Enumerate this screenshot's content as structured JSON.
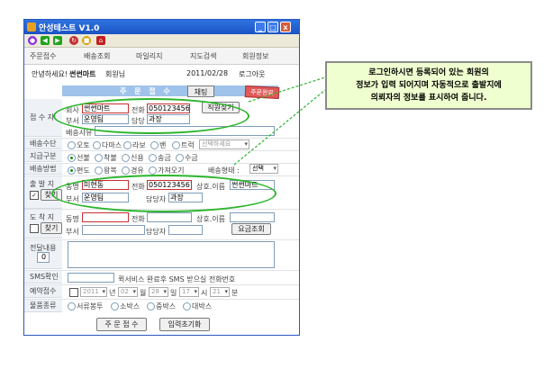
{
  "window": {
    "title": "안성테스트 V1.0",
    "min": "_",
    "max": "□",
    "close": "x"
  },
  "toolbar": {
    "icons": [
      "record-icon",
      "back-arrow-icon",
      "forward-arrow-icon",
      "refresh-icon",
      "stop-icon",
      "home-icon"
    ]
  },
  "menu": [
    "주문접수",
    "배송조회",
    "마일리지",
    "지도검색",
    "회원정보"
  ],
  "user": {
    "greeting": "안녕하세요!",
    "name": "썬썬마트",
    "suffix": "회원님",
    "date": "2011/02/28",
    "logout": "로그아웃"
  },
  "section": {
    "title": "주 문 접 수",
    "chat": "채팅",
    "red_button": "주문완료"
  },
  "receiver": {
    "label": "접 수 자",
    "company_label": "회사",
    "company": "썬썬마트",
    "phone_label": "전화",
    "phone": "0501234567",
    "dept_label": "부서",
    "dept": "운영팀",
    "manager_label": "담당",
    "manager": "과장",
    "find_button": "직원찾기",
    "reason_label": "배송사유"
  },
  "delivery_method": {
    "label": "배송수단",
    "options": [
      "오토",
      "다마스",
      "라보",
      "밴",
      "트럭"
    ],
    "select": "선택하세요"
  },
  "payment": {
    "label": "지급구분",
    "options": [
      "선불",
      "착불",
      "신용",
      "송금",
      "수금"
    ],
    "selected": "선불"
  },
  "shipping": {
    "label": "배송방법",
    "options": [
      "편도",
      "왕복",
      "경유",
      "가져오기"
    ],
    "selected": "편도",
    "type_label": "배송형태 :",
    "type_value": "선택"
  },
  "origin": {
    "label": "출 발 지",
    "find": "찾기",
    "dong_label": "동명",
    "dong": "미현동",
    "phone_label": "전화",
    "phone": "0501234567",
    "name_label": "상호.이름",
    "name": "썬썬마트",
    "dept_label": "부서",
    "dept": "운영팀",
    "manager_label": "담당자",
    "manager": "과장"
  },
  "destination": {
    "label": "도 착 지",
    "find": "찾기",
    "dong_label": "동명",
    "phone_label": "전화",
    "name_label": "상호.이름",
    "dept_label": "부서",
    "manager_label": "담당자",
    "fee_button": "요금조회"
  },
  "memo": {
    "label": "전달내용",
    "count": "0"
  },
  "sms": {
    "label": "SMS확인",
    "note": "퀵서비스 완료후 SMS 받으실 전화번호"
  },
  "reserve": {
    "label": "예약접수",
    "year": "2011",
    "year_unit": "년",
    "month": "02",
    "month_unit": "월",
    "day": "28",
    "day_unit": "일",
    "hour": "17",
    "hour_unit": "시",
    "minute": "21",
    "minute_unit": "분"
  },
  "goods": {
    "label": "물품종류",
    "options": [
      "서류봉투",
      "소박스",
      "중박스",
      "대박스"
    ]
  },
  "footer": {
    "submit": "주 문 접 수",
    "reset": "입력초기화"
  },
  "callout": {
    "line1": "로그인하시면 등록되어 있는 회원의",
    "line2": "정보가 입력 되어지며 자동적으로  출발지에",
    "line3": "의뢰자의 정보를 표시하여 줍니다."
  }
}
